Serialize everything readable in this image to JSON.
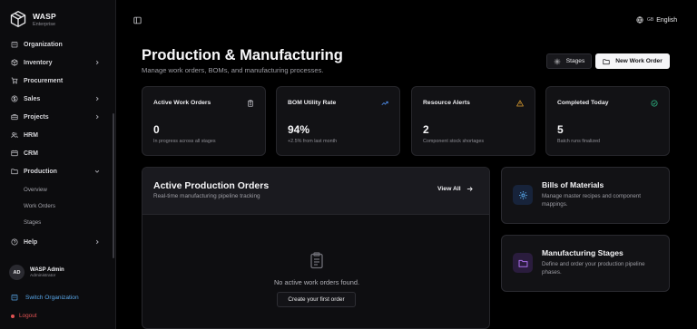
{
  "brand": {
    "name": "WASP",
    "subtitle": "Enterprise"
  },
  "sidebar": {
    "items": [
      {
        "label": "Organization",
        "icon": "building-icon"
      },
      {
        "label": "Inventory",
        "icon": "box-icon"
      },
      {
        "label": "Procurement",
        "icon": "cart-icon"
      },
      {
        "label": "Sales",
        "icon": "dollar-icon"
      },
      {
        "label": "Projects",
        "icon": "briefcase-icon"
      },
      {
        "label": "HRM",
        "icon": "users-icon"
      },
      {
        "label": "CRM",
        "icon": "contact-icon"
      },
      {
        "label": "Production",
        "icon": "folder-icon"
      },
      {
        "label": "Help",
        "icon": "help-icon"
      }
    ],
    "production_sub": [
      "Overview",
      "Work Orders",
      "Stages"
    ],
    "user": {
      "initials": "AD",
      "name": "WASP Admin",
      "role": "Administrator"
    },
    "switch_org": "Switch Organization",
    "logout": "Logout"
  },
  "topbar": {
    "lang_code": "GB",
    "lang_label": "English"
  },
  "header": {
    "title": "Production & Manufacturing",
    "subtitle": "Manage work orders, BOMs, and manufacturing processes.",
    "stages_button": "Stages",
    "new_work_order_button": "New Work Order"
  },
  "stats": [
    {
      "title": "Active Work Orders",
      "value": "0",
      "sub": "In progress across all stages",
      "icon": "clipboard-icon"
    },
    {
      "title": "BOM Utility Rate",
      "value": "94%",
      "sub": "+2.5% from last month",
      "icon": "trending-up-icon"
    },
    {
      "title": "Resource Alerts",
      "value": "2",
      "sub": "Component stock shortages",
      "icon": "warning-icon"
    },
    {
      "title": "Completed Today",
      "value": "5",
      "sub": "Batch runs finalized",
      "icon": "check-circle-icon"
    }
  ],
  "orders": {
    "title": "Active Production Orders",
    "subtitle": "Real-time manufacturing pipeline tracking",
    "view_all": "View All",
    "empty_text": "No active work orders found.",
    "empty_button": "Create your first order"
  },
  "features": [
    {
      "title": "Bills of Materials",
      "desc": "Manage master recipes and component mappings.",
      "icon": "gear-icon"
    },
    {
      "title": "Manufacturing Stages",
      "desc": "Define and order your production pipeline phases.",
      "icon": "folder-icon"
    }
  ],
  "colors": {
    "accent_blue": "#58a6e8",
    "trend_blue": "#4f8ff0",
    "warning": "#e0a030",
    "success": "#2fbf8a",
    "logout_red": "#e05353",
    "bom_icon_bg": "#17233a",
    "stages_icon_bg": "#2a1c3d",
    "stages_icon": "#a86ee8"
  }
}
